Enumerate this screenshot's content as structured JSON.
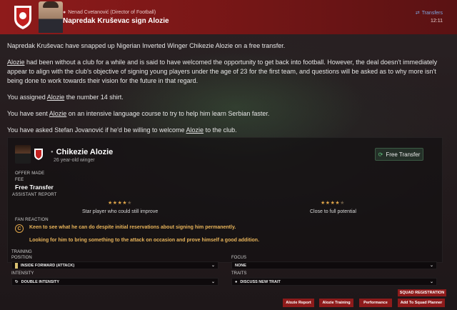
{
  "header": {
    "sender": "Nenad Cvetanović  (Director of Football)",
    "subject": "Napredak Kruševac sign Alozie",
    "tag": "Transfers",
    "time": "12:11"
  },
  "body": {
    "p1": "Napredak Kruševac have snapped up Nigerian Inverted Winger Chikezie Alozie on a free transfer.",
    "p2_name": "Alozie",
    "p2": " had been without a club for a while and is said to have welcomed the opportunity to get back into football. However, the deal doesn't immediately appear to align with the club's objective of signing young players under the age of 23 for the first team, and questions will be asked as to why more isn't being done to work towards their vision for the future in that regard.",
    "p3_pre": "You assigned ",
    "p3_name": "Alozie",
    "p3_post": " the number 14 shirt.",
    "p4_pre": "You have sent ",
    "p4_name": "Alozie",
    "p4_post": " on an intensive language course to try to help him learn Serbian faster.",
    "p5_pre": "You have asked Stefan Jovanović if he'd be willing to welcome ",
    "p5_name": "Alozie",
    "p5_post": " to the club."
  },
  "card": {
    "player_name": "Chikezie Alozie",
    "player_meta": "26 year-old winger",
    "free_transfer_btn": "Free Transfer",
    "offer_made_label": "OFFER MADE",
    "fee_label": "FEE",
    "fee_value": "Free Transfer",
    "assistant_report_label": "ASSISTANT REPORT",
    "current_stars": 4,
    "potential_stars": 4,
    "max_stars": 5,
    "stars_left_text": "Star player who could still improve",
    "stars_right_text": "Close to full potential",
    "fan_reaction_label": "FAN REACTION",
    "fan_line1": "Keen to see what he can do despite initial reservations about signing him permanently.",
    "fan_line2": "Looking for him to bring something to the attack on occasion and prove himself a good addition."
  },
  "training": {
    "training_label": "TRAINING",
    "position_label": "POSITION",
    "position_value": "INSIDE FORWARD (ATTACK)",
    "focus_label": "FOCUS",
    "focus_value": "NONE",
    "intensity_label": "INTENSITY",
    "intensity_value": "DOUBLE INTENSITY",
    "traits_label": "TRAITS",
    "traits_value": "DISCUSS NEW TRAIT"
  },
  "actions": {
    "squad_registration": "SQUAD REGISTRATION",
    "alozie_report": "Alozie Report",
    "alozie_training": "Alozie Training",
    "performance": "Performance",
    "add_to_squad_planner": "Add To Squad Planner"
  },
  "colors": {
    "brand_red": "#8e1b1b",
    "star_gold": "#e0a64a",
    "link_blue": "#7ea6e0"
  }
}
